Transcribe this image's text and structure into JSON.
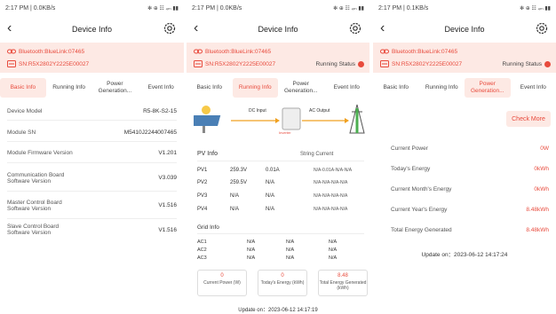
{
  "colors": {
    "accent": "#e84a3c",
    "banner": "#fde9e4"
  },
  "panels": [
    {
      "status_time": "2:17 PM | 0.0KB/s",
      "status_icons": "✻ ⊕ ☷ ₄ₘ ▮▮",
      "title": "Device Info",
      "bluetooth": "Bluetooth:BlueLink:07465",
      "sn": "SN:R5X2802Y2225E00027",
      "running_status": "",
      "tabs": [
        "Basic Info",
        "Running Info",
        "Power Generation...",
        "Event Info"
      ],
      "active_tab": 0,
      "rows": [
        {
          "k": "Device Model",
          "v": "R5-8K-S2-15"
        },
        {
          "k": "Module SN",
          "v": "M5410J2244007465"
        },
        {
          "k": "Module Firmware Version",
          "v": "V1.201"
        },
        {
          "k": "Communication Board Software Version",
          "v": "V3.039"
        },
        {
          "k": "Master Control Board Software Version",
          "v": "V1.516"
        },
        {
          "k": "Slave Control Board Software Version",
          "v": "V1.516"
        }
      ]
    },
    {
      "status_time": "2:17 PM | 0.0KB/s",
      "status_icons": "✻ ⊕ ☷ ₄ₘ ▮▮",
      "title": "Device Info",
      "bluetooth": "Bluetooth:BlueLink:07465",
      "sn": "SN:R5X2802Y2225E00027",
      "running_status": "Running Status",
      "tabs": [
        "Basic Info",
        "Running Info",
        "Power Generation...",
        "Event Info"
      ],
      "active_tab": 1,
      "dc_input": "DC Input",
      "ac_output": "AC Output",
      "inverter": "Inverter",
      "pv_info": "PV Info",
      "string_current": "String Current",
      "pv": [
        {
          "n": "PV1",
          "v": "259.3V",
          "a": "0.01A",
          "s": "N/A-0.01A-N/A-N/A"
        },
        {
          "n": "PV2",
          "v": "259.5V",
          "a": "N/A",
          "s": "N/A-N/A-N/A-N/A"
        },
        {
          "n": "PV3",
          "v": "N/A",
          "a": "N/A",
          "s": "N/A-N/A-N/A-N/A"
        },
        {
          "n": "PV4",
          "v": "N/A",
          "a": "N/A",
          "s": "N/A-N/A-N/A-N/A"
        }
      ],
      "grid_info": "Grid Info",
      "grid": [
        {
          "n": "AC1",
          "a": "N/A",
          "b": "N/A",
          "c": "N/A"
        },
        {
          "n": "AC2",
          "a": "N/A",
          "b": "N/A",
          "c": "N/A"
        },
        {
          "n": "AC3",
          "a": "N/A",
          "b": "N/A",
          "c": "N/A"
        }
      ],
      "cards": [
        {
          "n": "0",
          "l": "Current Power (W)"
        },
        {
          "n": "0",
          "l": "Today's Energy (kWh)"
        },
        {
          "n": "8.48",
          "l": "Total Energy Generated (kWh)"
        }
      ],
      "update": "Update on：2023-06-12 14:17:19"
    },
    {
      "status_time": "2:17 PM | 0.1KB/s",
      "status_icons": "✻ ⊕ ☷ ₄ₘ ▮▮",
      "title": "Device Info",
      "bluetooth": "Bluetooth:BlueLink:07465",
      "sn": "SN:R5X2802Y2225E00027",
      "running_status": "Running Status",
      "tabs": [
        "Basic Info",
        "Running Info",
        "Power Generation...",
        "Event Info"
      ],
      "active_tab": 2,
      "check_more": "Check More",
      "rows": [
        {
          "k": "Current Power",
          "v": "0W"
        },
        {
          "k": "Today's Energy",
          "v": "0kWh"
        },
        {
          "k": "Current Month's Energy",
          "v": "0kWh"
        },
        {
          "k": "Current Year's Energy",
          "v": "8.48kWh"
        },
        {
          "k": "Total Energy Generated",
          "v": "8.48kWh"
        }
      ],
      "update": "Update on：2023-06-12 14:17:24"
    }
  ]
}
